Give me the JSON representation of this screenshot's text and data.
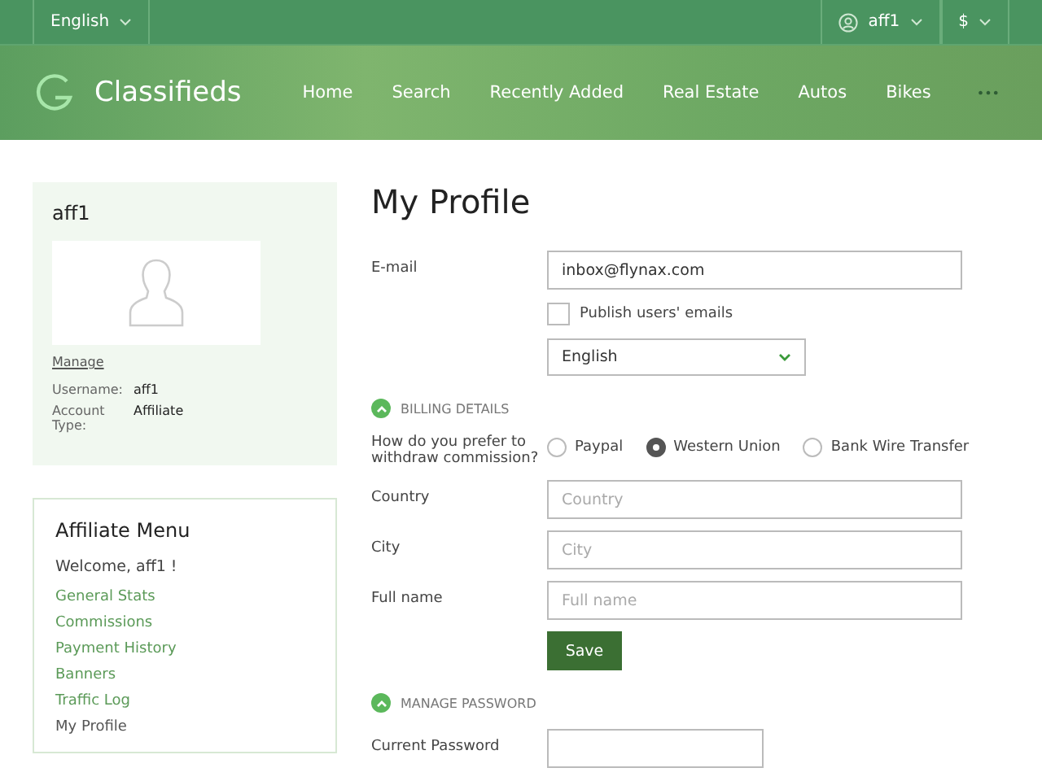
{
  "top_bar": {
    "language": "English",
    "user": "aff1",
    "currency": "$"
  },
  "header": {
    "logo_text": "Classifieds",
    "nav": [
      {
        "label": "Home"
      },
      {
        "label": "Search"
      },
      {
        "label": "Recently Added"
      },
      {
        "label": "Real Estate"
      },
      {
        "label": "Autos"
      },
      {
        "label": "Bikes"
      }
    ],
    "more": "•••"
  },
  "profile_card": {
    "name": "aff1",
    "manage": "Manage",
    "details": [
      {
        "label": "Username:",
        "value": "aff1"
      },
      {
        "label": "Account Type:",
        "value": "Affiliate"
      }
    ]
  },
  "affiliate_menu": {
    "title": "Affiliate Menu",
    "welcome": "Welcome, aff1 !",
    "items": [
      {
        "label": "General Stats",
        "selected": false
      },
      {
        "label": "Commissions",
        "selected": false
      },
      {
        "label": "Payment History",
        "selected": false
      },
      {
        "label": "Banners",
        "selected": false
      },
      {
        "label": "Traffic Log",
        "selected": false
      },
      {
        "label": "My Profile",
        "selected": true
      }
    ]
  },
  "main": {
    "title": "My Profile",
    "email": {
      "label": "E-mail",
      "value": "inbox@flynax.com"
    },
    "publish": {
      "label": "Publish users' emails",
      "checked": false
    },
    "language_select": "English",
    "billing": {
      "heading": "BILLING DETAILS",
      "expanded": true,
      "question": "How do you prefer to withdraw commission?",
      "options": [
        {
          "label": "Paypal",
          "selected": false
        },
        {
          "label": "Western Union",
          "selected": true
        },
        {
          "label": "Bank Wire Transfer",
          "selected": false
        }
      ],
      "fields": [
        {
          "label": "Country",
          "placeholder": "Country"
        },
        {
          "label": "City",
          "placeholder": "City"
        },
        {
          "label": "Full name",
          "placeholder": "Full name"
        }
      ],
      "save": "Save"
    },
    "password": {
      "heading": "MANAGE PASSWORD",
      "expanded": true,
      "fields": [
        {
          "label": "Current Password"
        }
      ]
    }
  }
}
